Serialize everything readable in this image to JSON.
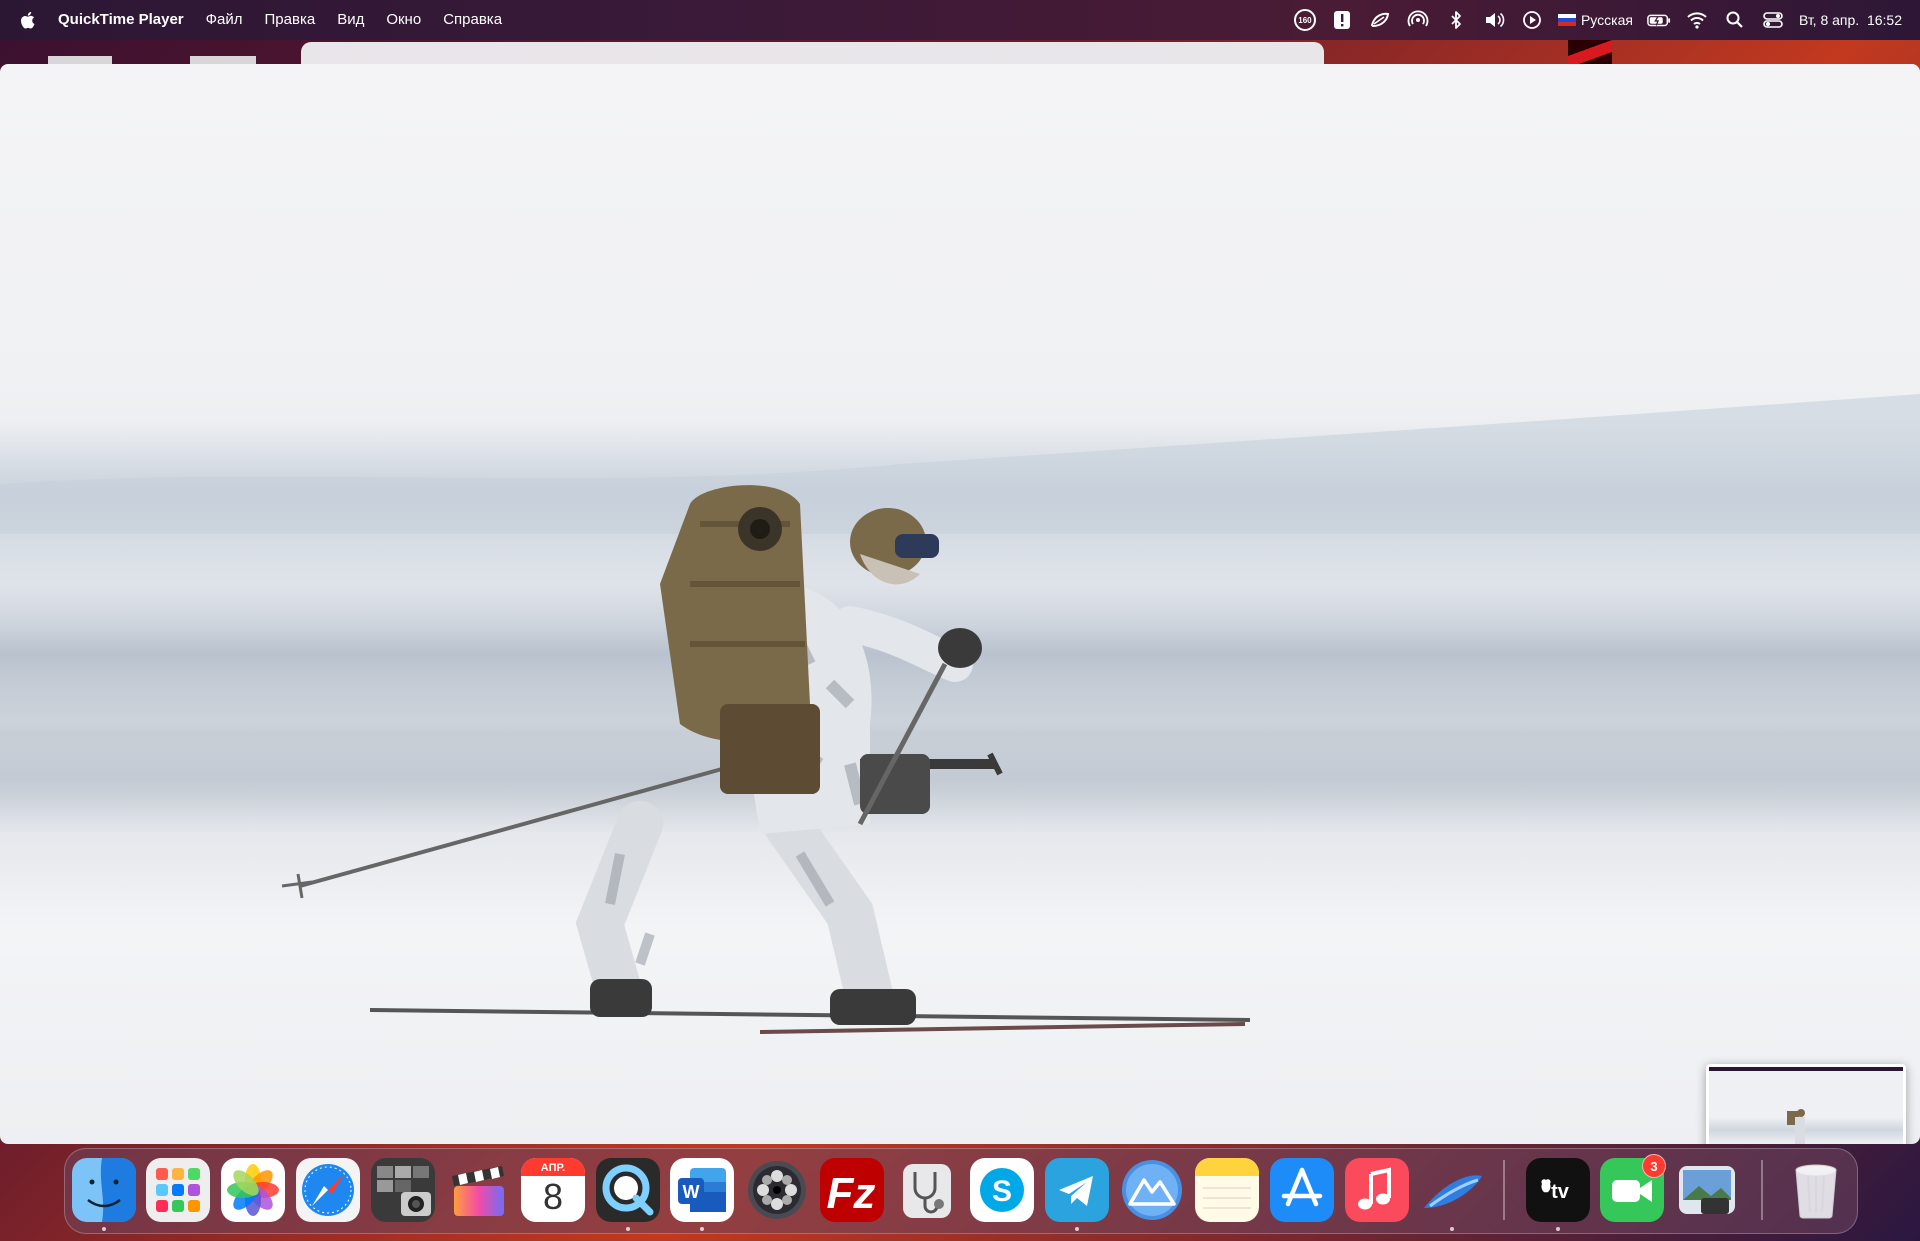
{
  "menubar": {
    "app_name": "QuickTime Player",
    "items": [
      "Файл",
      "Правка",
      "Вид",
      "Окно",
      "Справка"
    ],
    "status": {
      "badge_160": "160",
      "input_source": "Русская",
      "datetime": "Вт, 8 апр.  16:52"
    }
  },
  "video": {
    "description_icons": [
      "skier-figure"
    ]
  },
  "dock": {
    "calendar_month": "АПР.",
    "calendar_day": "8",
    "facetime_badge": "3",
    "items": [
      {
        "name": "finder",
        "icon": "finder-icon"
      },
      {
        "name": "launchpad",
        "icon": "launchpad-icon"
      },
      {
        "name": "photos",
        "icon": "photos-icon"
      },
      {
        "name": "safari",
        "icon": "safari-icon"
      },
      {
        "name": "image-capture",
        "icon": "image-capture-icon"
      },
      {
        "name": "final-cut",
        "icon": "clapper-icon"
      },
      {
        "name": "calendar",
        "icon": "calendar-icon"
      },
      {
        "name": "quicktime",
        "icon": "quicktime-icon"
      },
      {
        "name": "word",
        "icon": "word-icon"
      },
      {
        "name": "dvd-player",
        "icon": "film-reel-icon"
      },
      {
        "name": "filezilla",
        "icon": "filezilla-icon"
      },
      {
        "name": "disk-utility",
        "icon": "stethoscope-icon"
      },
      {
        "name": "skype",
        "icon": "skype-icon"
      },
      {
        "name": "telegram",
        "icon": "telegram-icon"
      },
      {
        "name": "monterey",
        "icon": "mountain-icon"
      },
      {
        "name": "notes",
        "icon": "notes-icon"
      },
      {
        "name": "app-store",
        "icon": "app-store-icon"
      },
      {
        "name": "music",
        "icon": "music-icon"
      },
      {
        "name": "proxyman",
        "icon": "swoosh-icon"
      },
      {
        "name": "apple-tv",
        "icon": "apple-tv-icon"
      },
      {
        "name": "facetime",
        "icon": "facetime-icon"
      },
      {
        "name": "preview",
        "icon": "preview-icon"
      },
      {
        "name": "trash",
        "icon": "trash-icon"
      }
    ]
  }
}
